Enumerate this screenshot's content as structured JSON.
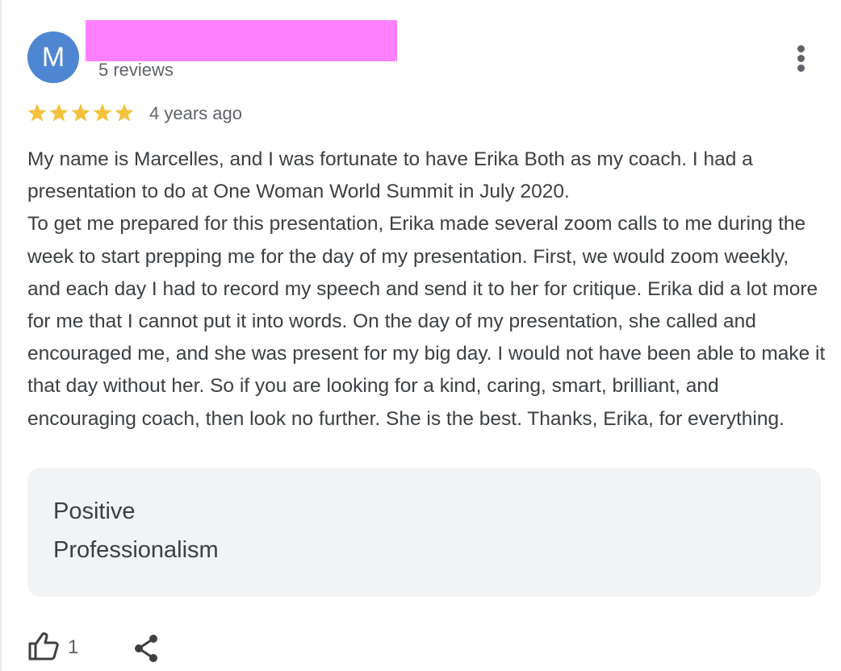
{
  "reviewer": {
    "avatar_initial": "M",
    "avatar_color": "#4f86d1",
    "name_redaction_color": "#ff80ff",
    "review_count": "5 reviews"
  },
  "review": {
    "rating": 5,
    "max_rating": 5,
    "star_color": "#f4c23c",
    "time_ago": "4 years ago",
    "text": "My name is Marcelles, and I was fortunate to have Erika Both as my coach. I had a presentation to do at One Woman World Summit in July 2020.\nTo get me prepared for this presentation, Erika made several zoom calls to me during the week to start prepping me for the day of my presentation. First, we would zoom weekly, and each day I had to record my speech and send it to her for critique. Erika did a lot more for me that I cannot put it into words. On the day of my presentation, she called and encouraged me, and she was present for my big day. I would not have been able to make it that day without her. So if you are looking for a kind, caring, smart, brilliant, and encouraging coach, then look no further. She is the best. Thanks, Erika, for everything.",
    "attributes": [
      "Positive",
      "Professionalism"
    ]
  },
  "actions": {
    "like_icon": "thumbs-up-icon",
    "like_count": "1",
    "share_icon": "share-icon",
    "more_icon": "more-vert-icon"
  }
}
